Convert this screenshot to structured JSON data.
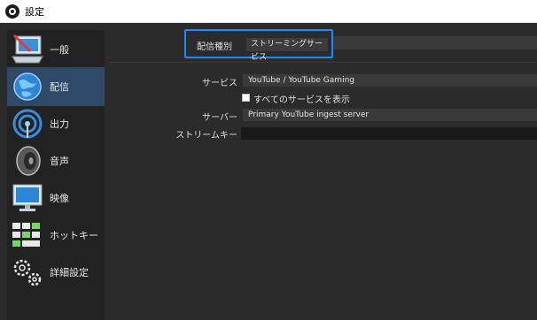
{
  "window": {
    "title": "設定"
  },
  "sidebar": {
    "items": [
      {
        "label": "一般",
        "icon": "computer-icon",
        "active": false
      },
      {
        "label": "配信",
        "icon": "globe-icon",
        "active": true
      },
      {
        "label": "出力",
        "icon": "broadcast-icon",
        "active": false
      },
      {
        "label": "音声",
        "icon": "speaker-icon",
        "active": false
      },
      {
        "label": "映像",
        "icon": "monitor-icon",
        "active": false
      },
      {
        "label": "ホットキー",
        "icon": "keyboard-icon",
        "active": false
      },
      {
        "label": "詳細設定",
        "icon": "gears-icon",
        "active": false
      }
    ]
  },
  "stream": {
    "type_label": "配信種別",
    "type_value": "ストリーミングサービス",
    "service_label": "サービス",
    "service_value": "YouTube / YouTube Gaming",
    "show_all_label": "すべてのサービスを表示",
    "server_label": "サーバー",
    "server_value": "Primary YouTube ingest server",
    "key_label": "ストリームキー",
    "key_value": ""
  },
  "colors": {
    "accent_border": "#1a8cff",
    "active_item": "#2f4a66",
    "background": "#2b2b2b",
    "sidebar": "#222222"
  }
}
